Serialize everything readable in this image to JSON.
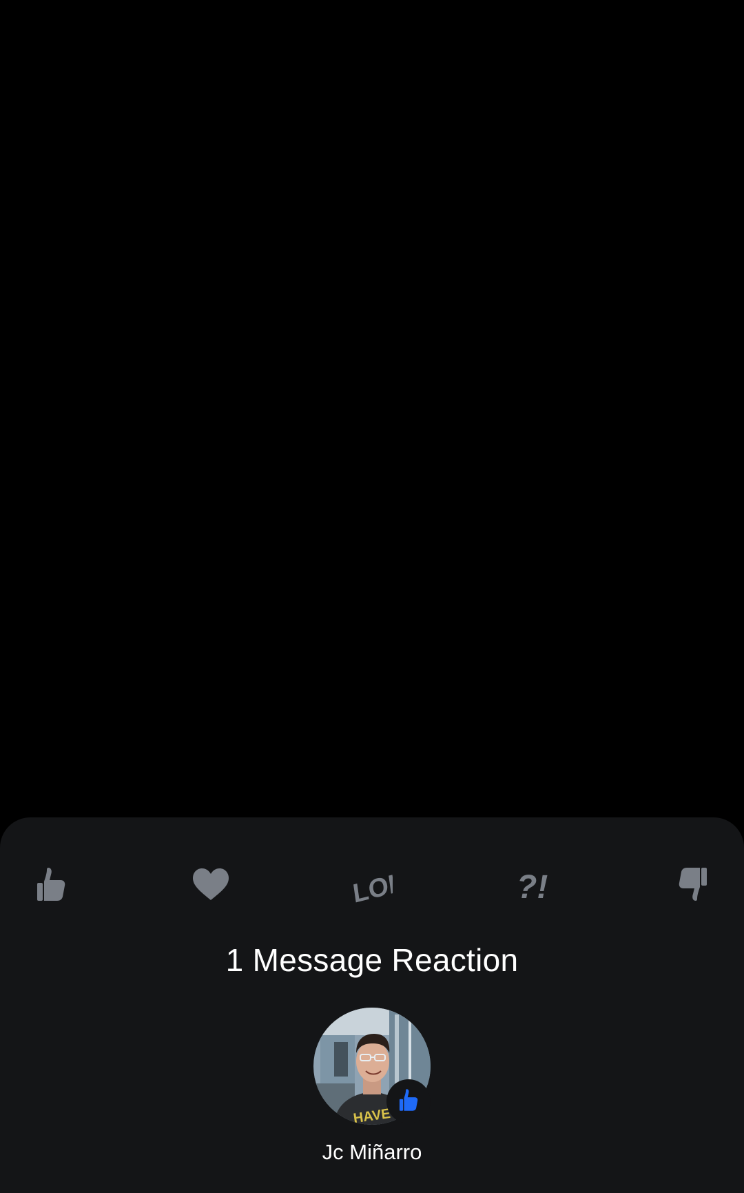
{
  "sheet": {
    "reactions": [
      {
        "name": "thumbs-up",
        "icon": "thumbs-up-icon"
      },
      {
        "name": "heart",
        "icon": "heart-icon"
      },
      {
        "name": "lol",
        "icon": "lol-icon",
        "text": "LOL"
      },
      {
        "name": "question-exclamation",
        "icon": "question-exclamation-icon",
        "text": "?!"
      },
      {
        "name": "thumbs-down",
        "icon": "thumbs-down-icon"
      }
    ],
    "title": "1 Message Reaction",
    "reactors": [
      {
        "name": "Jc Miñarro",
        "avatar": "avatar-photo",
        "reaction_icon": "thumbs-up-icon"
      }
    ]
  },
  "colors": {
    "background": "#000000",
    "sheet": "#141517",
    "reaction_icon": "#7a7f87",
    "accent_blue": "#1f6af7",
    "text": "#ffffff"
  }
}
